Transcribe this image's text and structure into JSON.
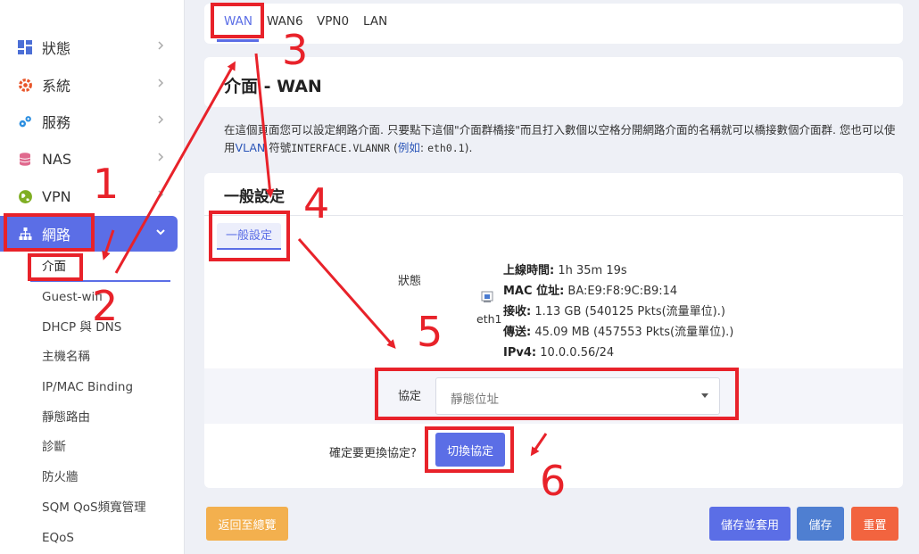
{
  "sidebar": {
    "items": [
      {
        "label": "狀態",
        "icon": "dashboard-icon"
      },
      {
        "label": "系統",
        "icon": "gear-icon"
      },
      {
        "label": "服務",
        "icon": "puzzle-icon"
      },
      {
        "label": "NAS",
        "icon": "database-icon"
      },
      {
        "label": "VPN",
        "icon": "globe-icon"
      },
      {
        "label": "網路",
        "icon": "network-icon"
      }
    ],
    "subitems": [
      "介面",
      "Guest-wifi",
      "DHCP 與 DNS",
      "主機名稱",
      "IP/MAC Binding",
      "靜態路由",
      "診斷",
      "防火牆",
      "SQM QoS頻寬管理",
      "EQoS"
    ]
  },
  "tabs": [
    "WAN",
    "WAN6",
    "VPN0",
    "LAN"
  ],
  "page": {
    "title": "介面 - WAN",
    "desc_1": "在這個頁面您可以設定網路介面. 只要點下這個\"介面群橋接\"而且打入數個以空格分開網路介面的名稱就可以橋接數個介面群. 您也可以使用",
    "desc_vlan": "VLAN",
    "desc_2": " 符號",
    "desc_code": "INTERFACE.VLANNR",
    "desc_3": " (",
    "desc_example": "例如",
    "desc_4": ": ",
    "desc_code2": "eth0.1",
    "desc_5": ")."
  },
  "general": {
    "section_title": "一般設定",
    "inner_tab": "一般設定",
    "status_label": "狀態",
    "device": "eth1",
    "uptime_label": "上線時間:",
    "uptime_value": " 1h 35m 19s",
    "mac_label": "MAC 位址:",
    "mac_value": " BA:E9:F8:9C:B9:14",
    "rx_label": "接收:",
    "rx_value": " 1.13 GB (540125 Pkts(流量單位).)",
    "tx_label": "傳送:",
    "tx_value": " 45.09 MB (457553 Pkts(流量單位).)",
    "ipv4_label": "IPv4:",
    "ipv4_value": " 10.0.0.56/24",
    "protocol_label": "協定",
    "protocol_value": "靜態位址",
    "confirm_text": "確定要更換協定?",
    "switch_button": "切換協定"
  },
  "footer": {
    "back": "返回至總覽",
    "save_apply": "儲存並套用",
    "save": "儲存",
    "reset": "重置"
  },
  "annotations": [
    "1",
    "2",
    "3",
    "4",
    "5",
    "6"
  ],
  "colors": {
    "accent": "#5b6ee6",
    "annotation": "#e8222a",
    "warning": "#f3b04e",
    "danger": "#f2643f"
  }
}
